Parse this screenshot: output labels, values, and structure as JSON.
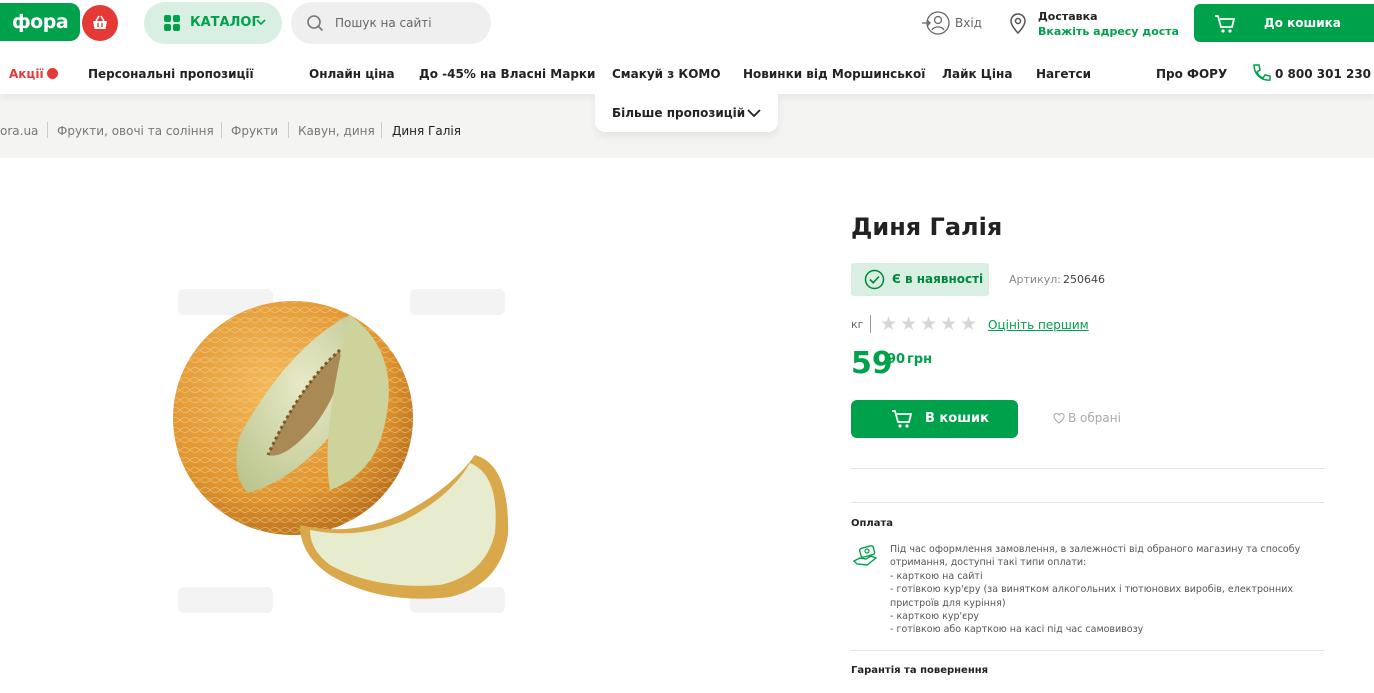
{
  "header": {
    "logo_text": "фора",
    "catalog_label": "КАТАЛОГ",
    "search_placeholder": "Пошук на сайті",
    "login_label": "Вхід",
    "delivery_title": "Доставка",
    "delivery_sub": "Вкажіть адресу доста...",
    "cart_label": "До кошика"
  },
  "nav": {
    "promo": "Акції",
    "items": [
      "Персональні пропозиції",
      "Онлайн ціна",
      "До -45% на Власні Марки",
      "Смакуй з КОМО",
      "Новинки від Моршинської",
      "Лайк Ціна",
      "Нагетси"
    ],
    "about": "Про ФОРУ",
    "phone": "0 800 301 230",
    "more": "Більше пропозицій"
  },
  "breadcrumb": [
    "ora.ua",
    "Фрукти, овочі та соління",
    "Фрукти",
    "Кавун, диня",
    "Диня Галія"
  ],
  "product": {
    "title": "Диня Галія",
    "stock": "Є в наявності",
    "sku_label": "Артикул:",
    "sku": "250646",
    "unit": "кг",
    "rate_link": "Оцініть першим",
    "price_main": "59",
    "price_cents": "90",
    "price_currency": "грн",
    "buy_label": "В кошик",
    "fav_label": "В обрані",
    "rating": 0
  },
  "payment": {
    "title": "Оплата",
    "intro": "Під час оформлення замовлення, в залежності від обраного магазину та способу отримання, доступні такі типи оплати:",
    "options": [
      "- карткою на сайті",
      "- готівкою кур'єру (за винятком алкогольних і тютюнових виробів, електронних пристроїв для куріння)",
      "- карткою кур'єру",
      "- готівкою або карткою на касі під час самовивозу"
    ]
  },
  "guarantee": {
    "title": "Гарантія та повернення"
  },
  "colors": {
    "brand_green": "#00a14b",
    "promo_red": "#e53935",
    "stock_bg": "#d9efe2"
  }
}
